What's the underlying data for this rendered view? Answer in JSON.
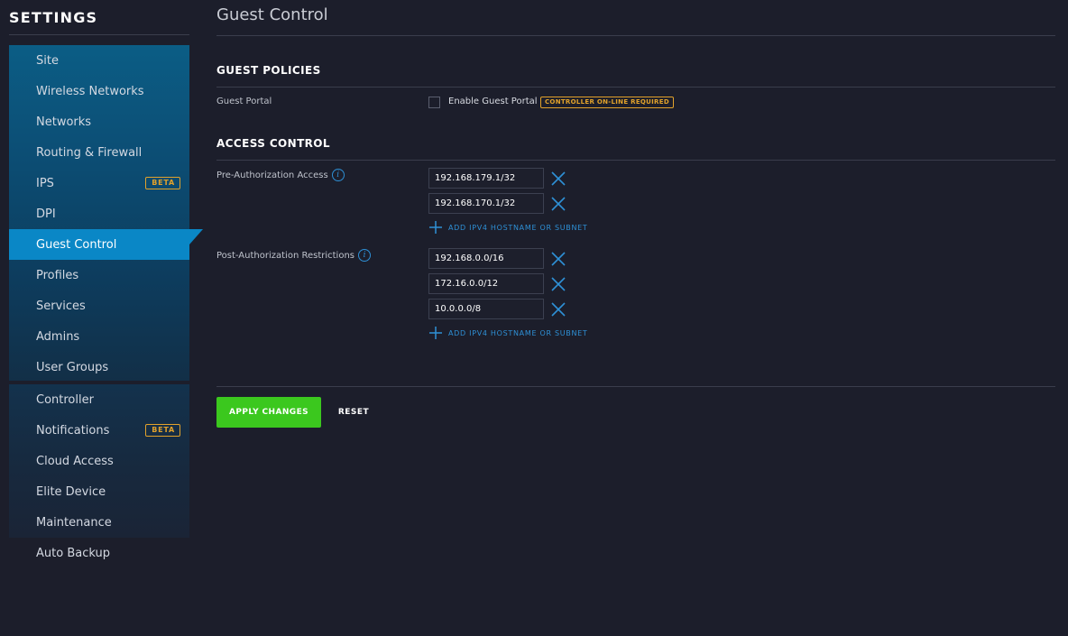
{
  "sidebar": {
    "title": "SETTINGS",
    "items": [
      {
        "label": "Site"
      },
      {
        "label": "Wireless Networks"
      },
      {
        "label": "Networks"
      },
      {
        "label": "Routing & Firewall"
      },
      {
        "label": "IPS",
        "badge": "BETA"
      },
      {
        "label": "DPI"
      },
      {
        "label": "Guest Control",
        "active": true
      },
      {
        "label": "Profiles"
      },
      {
        "label": "Services"
      },
      {
        "label": "Admins"
      },
      {
        "label": "User Groups"
      },
      {
        "label": "Controller"
      },
      {
        "label": "Notifications",
        "badge": "BETA"
      },
      {
        "label": "Cloud Access"
      },
      {
        "label": "Elite Device"
      },
      {
        "label": "Maintenance"
      },
      {
        "label": "Auto Backup"
      }
    ]
  },
  "main": {
    "title": "Guest Control",
    "guest_policies": {
      "heading": "GUEST POLICIES",
      "guest_portal_label": "Guest Portal",
      "enable_label": "Enable Guest Portal",
      "enabled": false,
      "badge": "CONTROLLER ON-LINE REQUIRED"
    },
    "access_control": {
      "heading": "ACCESS CONTROL",
      "pre_auth": {
        "label": "Pre-Authorization Access",
        "entries": [
          "192.168.179.1/32",
          "192.168.170.1/32"
        ],
        "add_label": "ADD IPV4 HOSTNAME OR SUBNET"
      },
      "post_auth": {
        "label": "Post-Authorization Restrictions",
        "entries": [
          "192.168.0.0/16",
          "172.16.0.0/12",
          "10.0.0.0/8"
        ],
        "add_label": "ADD IPV4 HOSTNAME OR SUBNET"
      }
    },
    "actions": {
      "apply": "APPLY CHANGES",
      "reset": "RESET"
    }
  },
  "colors": {
    "background": "#1c1e2b",
    "accent_blue": "#0a87c6",
    "link_blue": "#2e90d6",
    "apply_green": "#3bc81e",
    "badge_orange": "#e2a22b"
  },
  "icons": {
    "info": "info-icon",
    "remove": "close-icon",
    "add": "plus-icon"
  }
}
